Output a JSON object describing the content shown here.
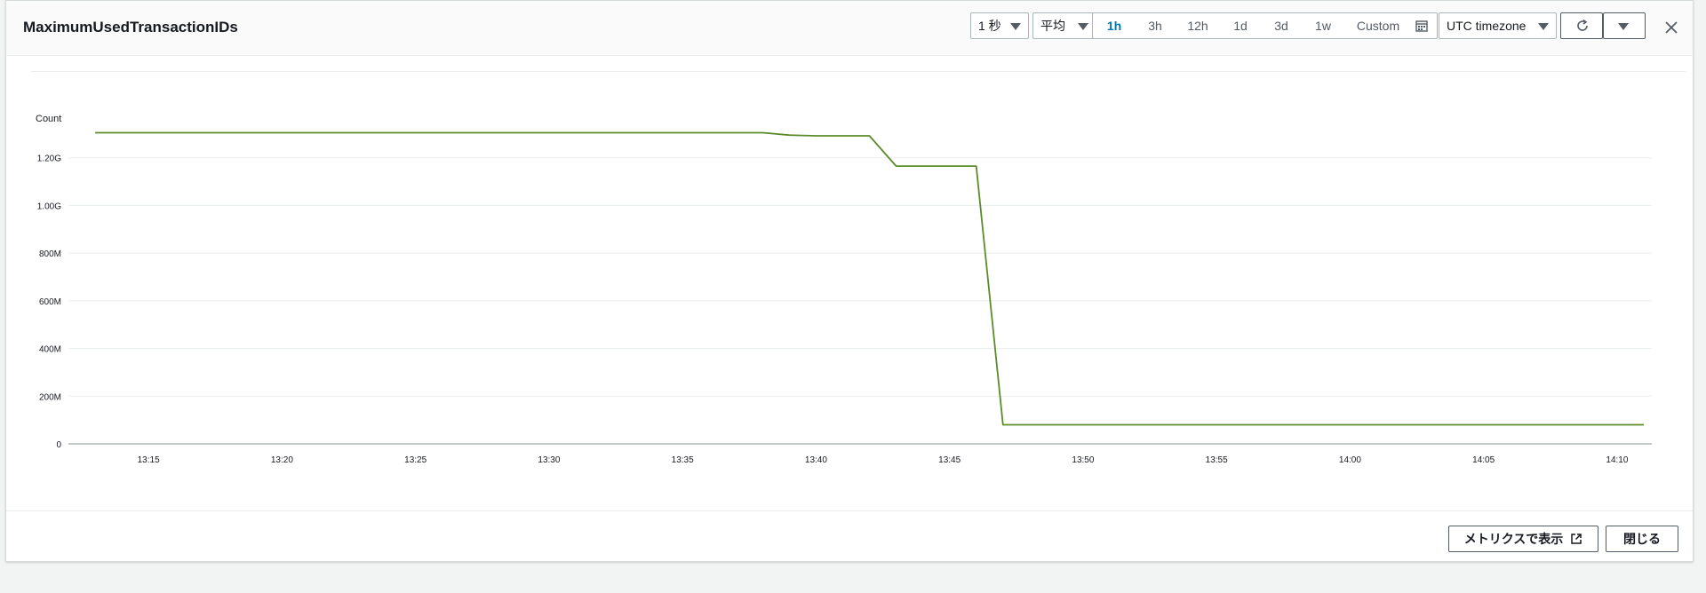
{
  "modal": {
    "title": "MaximumUsedTransactionIDs"
  },
  "toolbar": {
    "period": "1 秒",
    "statistic": "平均",
    "ranges": [
      "1h",
      "3h",
      "12h",
      "1d",
      "3d",
      "1w"
    ],
    "active_range": "1h",
    "custom_label": "Custom",
    "timezone": "UTC timezone"
  },
  "icons": {
    "refresh": "refresh-icon",
    "dropdown": "caret-down-icon",
    "close": "close-icon",
    "calendar": "calendar-icon",
    "external": "external-link-icon"
  },
  "footer": {
    "view_metrics_label": "メトリクスで表示",
    "close_label": "閉じる"
  },
  "colors": {
    "series": "#5b8c2a",
    "active": "#0073bb"
  },
  "chart_data": {
    "type": "line",
    "ylabel": "Count",
    "y_ticks": [
      "0",
      "200M",
      "400M",
      "600M",
      "800M",
      "1.00G",
      "1.20G"
    ],
    "ylim": [
      0,
      1400000000
    ],
    "x_ticks": [
      "13:15",
      "13:20",
      "13:25",
      "13:30",
      "13:35",
      "13:40",
      "13:45",
      "13:50",
      "13:55",
      "14:00",
      "14:05",
      "14:10"
    ],
    "grid": true,
    "series": [
      {
        "points": [
          [
            "13:13",
            1305000000
          ],
          [
            "13:38",
            1305000000
          ],
          [
            "13:39",
            1295000000
          ],
          [
            "13:40",
            1292000000
          ],
          [
            "13:42",
            1292000000
          ],
          [
            "13:43",
            1165000000
          ],
          [
            "13:46",
            1165000000
          ],
          [
            "13:47",
            80000000
          ],
          [
            "14:11",
            80000000
          ]
        ]
      }
    ]
  }
}
